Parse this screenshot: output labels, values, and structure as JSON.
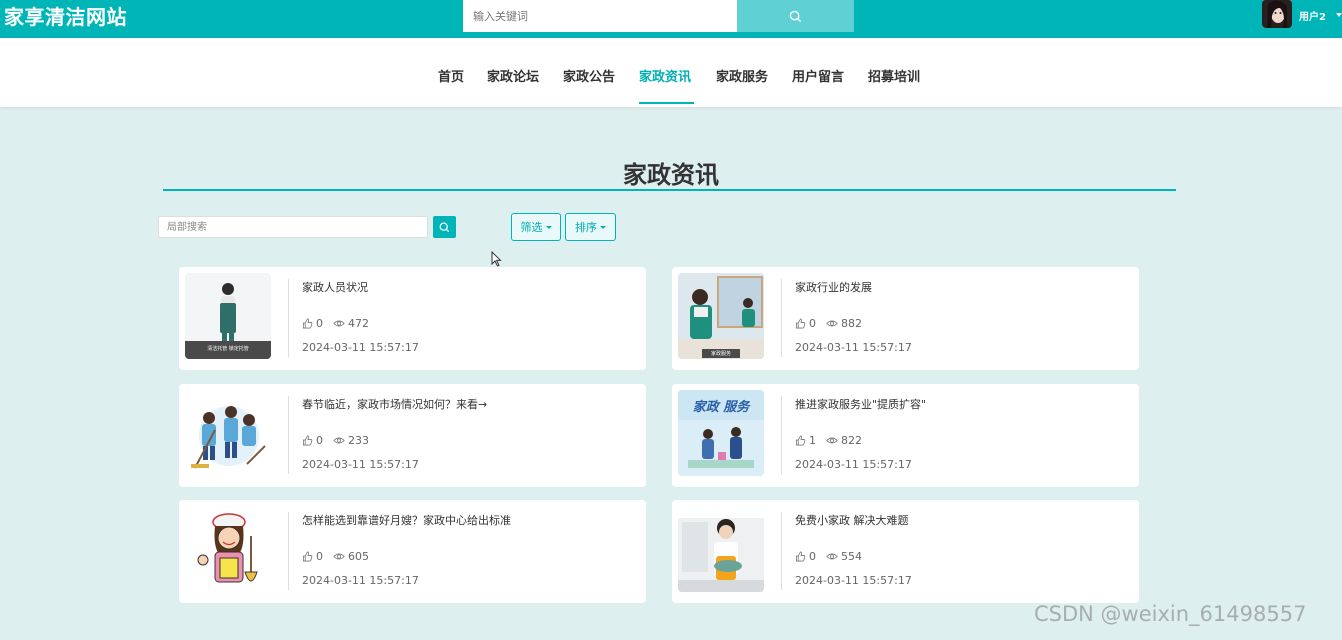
{
  "header": {
    "site_title": "家享清洁网站",
    "search_placeholder": "输入关键词",
    "user_name": "用户2"
  },
  "nav": {
    "items": [
      {
        "label": "首页"
      },
      {
        "label": "家政论坛"
      },
      {
        "label": "家政公告"
      },
      {
        "label": "家政资讯",
        "active": true
      },
      {
        "label": "家政服务"
      },
      {
        "label": "用户留言"
      },
      {
        "label": "招募培训"
      }
    ]
  },
  "main": {
    "title": "家政资讯",
    "local_search_placeholder": "局部搜索",
    "filter_label": "筛选",
    "sort_label": "排序"
  },
  "articles": [
    {
      "title": "家政人员状况",
      "likes": "0",
      "views": "472",
      "date": "2024-03-11 15:57:17",
      "thumb_caption": "清洁托管 锁定托管"
    },
    {
      "title": "家政行业的发展",
      "likes": "0",
      "views": "882",
      "date": "2024-03-11 15:57:17",
      "thumb_caption": "家政服务"
    },
    {
      "title": "春节临近，家政市场情况如何？来看→",
      "likes": "0",
      "views": "233",
      "date": "2024-03-11 15:57:17"
    },
    {
      "title": "推进家政服务业\"提质扩容\"",
      "likes": "1",
      "views": "822",
      "date": "2024-03-11 15:57:17",
      "thumb_caption": "家政 服务"
    },
    {
      "title": "怎样能选到靠谱好月嫂？家政中心给出标准",
      "likes": "0",
      "views": "605",
      "date": "2024-03-11 15:57:17"
    },
    {
      "title": "免费小家政 解决大难题",
      "likes": "0",
      "views": "554",
      "date": "2024-03-11 15:57:17"
    }
  ],
  "watermark": "CSDN @weixin_61498557",
  "colors": {
    "primary": "#00b5b8",
    "primary_light": "#5fd0d3",
    "page_bg": "#deeff0"
  }
}
